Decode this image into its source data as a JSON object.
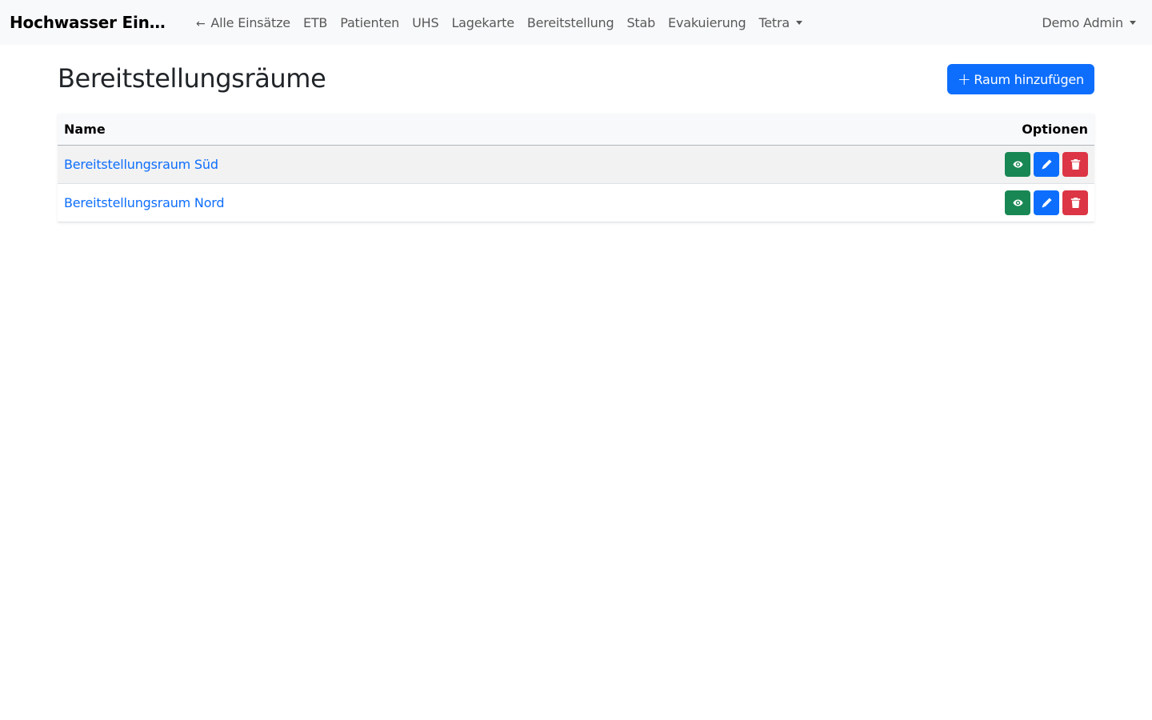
{
  "navbar": {
    "brand": "Hochwasser Einsatz",
    "back_arrow": "←",
    "links": [
      {
        "label": "Alle Einsätze"
      },
      {
        "label": "ETB"
      },
      {
        "label": "Patienten"
      },
      {
        "label": "UHS"
      },
      {
        "label": "Lagekarte"
      },
      {
        "label": "Bereitstellung"
      },
      {
        "label": "Stab"
      },
      {
        "label": "Evakuierung"
      },
      {
        "label": "Tetra"
      }
    ],
    "user": "Demo Admin"
  },
  "page": {
    "title": "Bereitstellungsräume",
    "add_button_label": "Raum hinzufügen",
    "add_button_icon": "+"
  },
  "table": {
    "columns": [
      "Name",
      "Optionen"
    ],
    "rows": [
      {
        "name": "Bereitstellungsraum Süd"
      },
      {
        "name": "Bereitstellungsraum Nord"
      }
    ]
  },
  "icons": {
    "view": "eye-icon",
    "edit": "pencil-icon",
    "delete": "trash-icon"
  },
  "colors": {
    "primary": "#0d6efd",
    "success": "#198754",
    "danger": "#dc3545"
  }
}
